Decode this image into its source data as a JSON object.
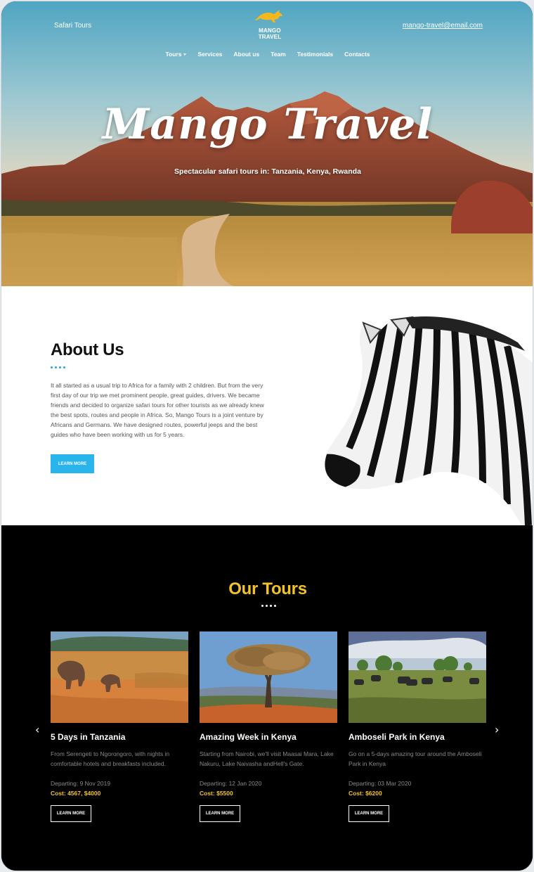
{
  "header": {
    "left_label": "Safari Tours",
    "brand": "MANGO TRAVEL",
    "email": "mango-travel@email.com"
  },
  "nav": {
    "items": [
      "Tours",
      "Services",
      "About us",
      "Team",
      "Testimonials",
      "Contacts"
    ]
  },
  "hero": {
    "title": "Mango Travel",
    "subtitle": "Spectacular safari tours in: Tanzania, Kenya, Rwanda"
  },
  "about": {
    "title": "About Us",
    "text": "It all started as a usual trip to Africa for a family with 2 children. But from the very first day of our trip we met prominent people, great guides, drivers. We became friends and decided to organize safari tours for other tourists as we already knew the best spots, routes and people in Africa. So, Mango Tours is a joint venture by Africans and Germans. We have designed routes, powerful jeeps and the best guides who have been working with us for 5 years.",
    "button": "LEARN MORE",
    "accent_color": "#2ab4ec"
  },
  "tours": {
    "title": "Our Tours",
    "accent_color": "#f3c326",
    "cards": [
      {
        "title": "5 Days in Tanzania",
        "description": "From Serengeti to Ngorongoro, with nights in comfortable hotels and breakfasts included.",
        "departing": "Departing: 9 Nov 2019",
        "cost": "Cost: 4567, $4000",
        "button": "LEARN MORE"
      },
      {
        "title": "Amazing Week in Kenya",
        "description": "Starting from Nairobi, we'll visit Maasai Mara, Lake Nakuru, Lake Naivasha andHell's Gate.",
        "departing": "Departing: 12 Jan 2020",
        "cost": "Cost: $5500",
        "button": "LEARN MORE"
      },
      {
        "title": "Amboseli Park in Kenya",
        "description": "Go on a 5-days amazing tour around the Amboseli Park in Kenya",
        "departing": "Departing: 03 Mar 2020",
        "cost": "Cost: $6200",
        "button": "LEARN MORE"
      }
    ]
  }
}
